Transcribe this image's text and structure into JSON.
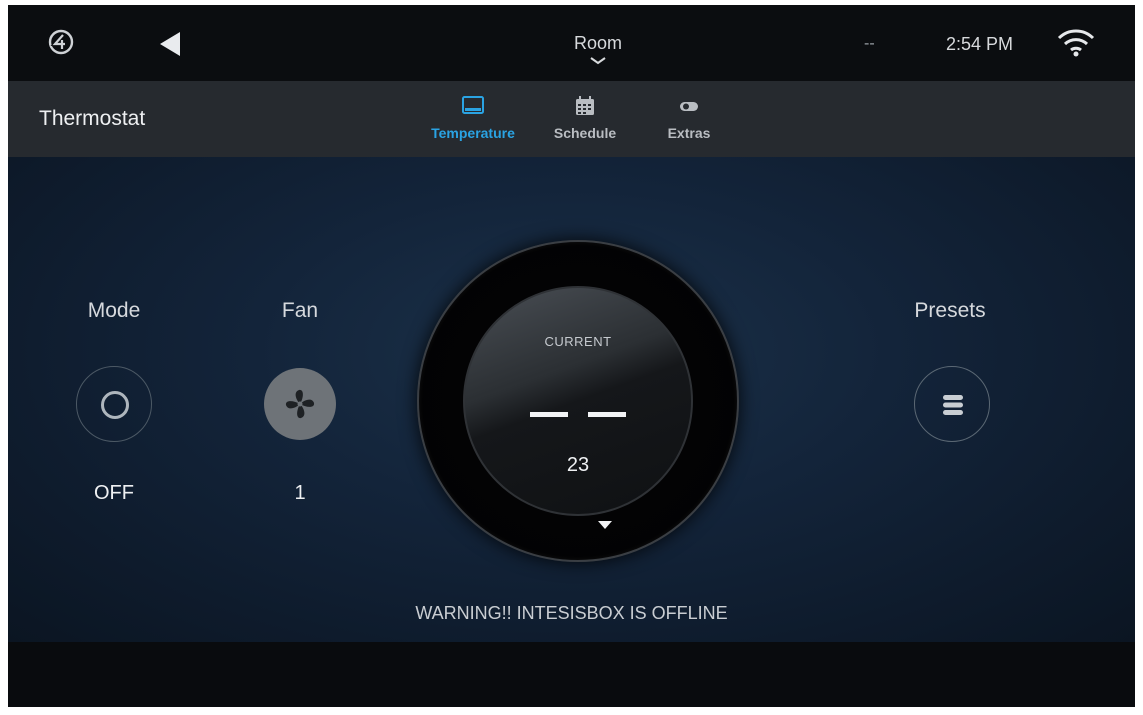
{
  "topbar": {
    "room_label": "Room",
    "status_indicator": "--",
    "time": "2:54 PM"
  },
  "subnav": {
    "page_title": "Thermostat",
    "tabs": [
      {
        "label": "Temperature",
        "icon": "thermostat-display-icon",
        "active": true
      },
      {
        "label": "Schedule",
        "icon": "calendar-icon",
        "active": false
      },
      {
        "label": "Extras",
        "icon": "toggle-icon",
        "active": false
      }
    ]
  },
  "controls": {
    "mode": {
      "label": "Mode",
      "value": "OFF",
      "icon": "mode-ring-icon"
    },
    "fan": {
      "label": "Fan",
      "value": "1",
      "icon": "fan-icon"
    },
    "presets": {
      "label": "Presets",
      "icon": "list-icon"
    }
  },
  "dial": {
    "caption": "CURRENT",
    "reading_display": "— —",
    "setpoint": "23"
  },
  "warning": "WARNING!! INTESISBOX IS OFFLINE",
  "colors": {
    "accent": "#2aa3e3",
    "background_top": "#0b0d10",
    "subnav": "#262a2f",
    "main_bg": "#13243a"
  }
}
